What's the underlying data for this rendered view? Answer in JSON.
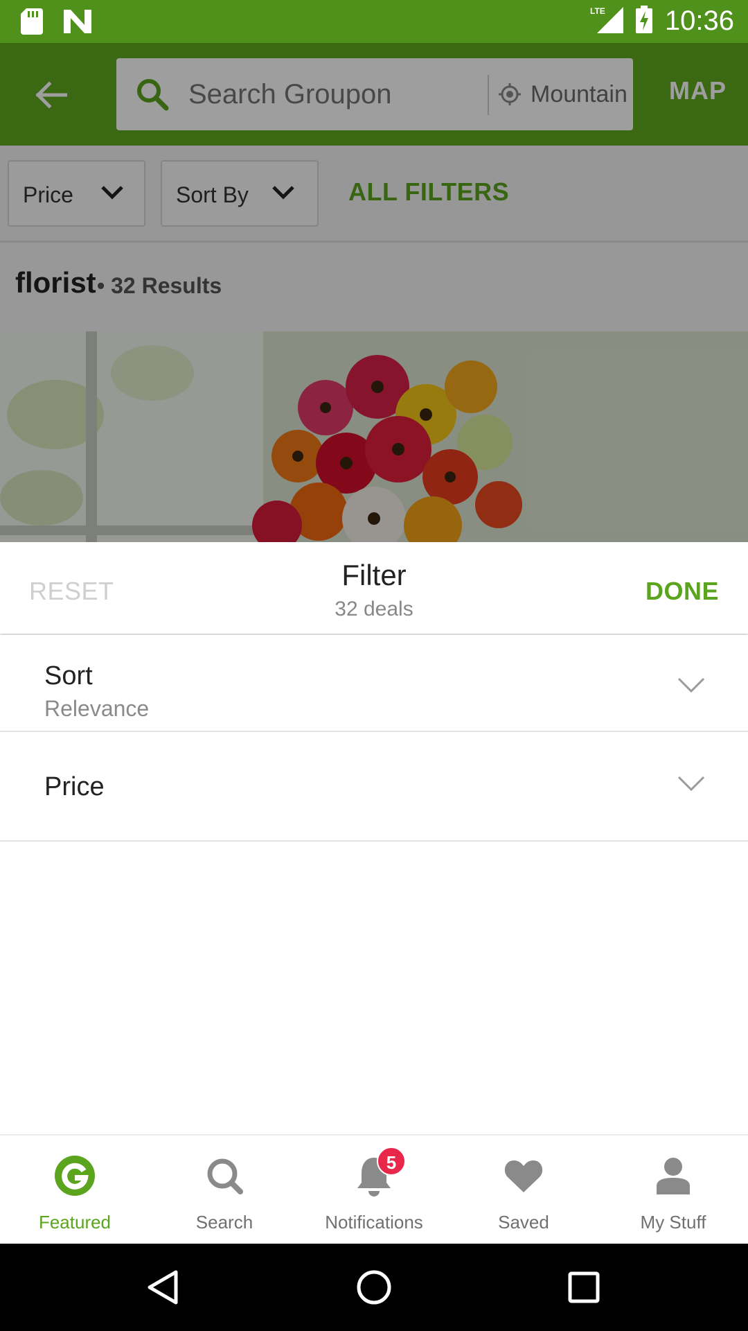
{
  "status_bar": {
    "time": "10:36",
    "network": "LTE",
    "icons": [
      "sd-card-icon",
      "n-notification-icon",
      "signal-icon",
      "battery-charging-icon"
    ]
  },
  "app_bar": {
    "search_placeholder": "Search Groupon",
    "location": "Mountain",
    "map_label": "MAP"
  },
  "filter_bar": {
    "price_label": "Price",
    "sort_label": "Sort By",
    "all_filters_label": "ALL FILTERS"
  },
  "results": {
    "query": "florist",
    "count_text": "• 32 Results"
  },
  "filter_sheet": {
    "reset_label": "RESET",
    "title": "Filter",
    "subtitle": "32 deals",
    "done_label": "DONE",
    "rows": [
      {
        "label": "Sort",
        "value": "Relevance"
      },
      {
        "label": "Price",
        "value": ""
      }
    ]
  },
  "bottom_nav": {
    "items": [
      {
        "label": "Featured",
        "icon": "groupon-g-icon",
        "active": true
      },
      {
        "label": "Search",
        "icon": "search-icon",
        "active": false
      },
      {
        "label": "Notifications",
        "icon": "bell-icon",
        "active": false,
        "badge": "5"
      },
      {
        "label": "Saved",
        "icon": "heart-icon",
        "active": false
      },
      {
        "label": "My Stuff",
        "icon": "person-icon",
        "active": false
      }
    ]
  },
  "colors": {
    "brand_green": "#60a81f",
    "status_green": "#4f911a",
    "accent_green": "#5aa41e",
    "badge_red": "#e8274a"
  }
}
